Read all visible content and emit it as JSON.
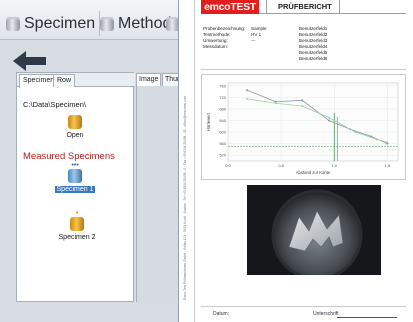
{
  "ribbon": {
    "tabs": [
      {
        "label": "Specimen"
      },
      {
        "label": "Method"
      }
    ]
  },
  "panel": {
    "tabs": [
      {
        "label": "Specimen"
      },
      {
        "label": "Row"
      }
    ],
    "path": "C:\\Data\\Specimen\\",
    "open_label": "Open",
    "measured_title": "Measured Specimens",
    "specimens": [
      {
        "label": "Specimen 1",
        "selected": true
      },
      {
        "label": "Specimen 2",
        "selected": false
      }
    ]
  },
  "viewer": {
    "tabs": [
      {
        "label": "Image"
      },
      {
        "label": "Thum"
      }
    ]
  },
  "report": {
    "logo": "emcoTEST",
    "title": "PRÜFBERICHT",
    "side_text": "Emco-Test Prüfmaschinen GmbH · Kellau 174 · 5431 Kuchl · Austria · Tel +43 6244 20438 - 0 · Fax +43 6244 20438 - 32 · office@emcotest.com",
    "info": [
      {
        "key": "Probenbezeichnung:",
        "value": "Sample"
      },
      {
        "key": "Testmethode:",
        "value": "HV 1"
      },
      {
        "key": "Umwertung:",
        "value": "---"
      },
      {
        "key": "Messdatum:",
        "value": ""
      }
    ],
    "user_fields": [
      "Benutzerfeld1",
      "Benutzerfeld2",
      "Benutzerfeld3",
      "Benutzerfeld4",
      "Benutzerfeld5",
      "Benutzerfeld6"
    ],
    "footer_date": "Datum:",
    "footer_sign": "Unterschrift"
  },
  "chart_data": {
    "type": "line",
    "title": "",
    "xlabel": "Abstand zur Kante",
    "ylabel": "Härtewert",
    "xlim": [
      0,
      1.6
    ],
    "ylim": [
      500,
      770
    ],
    "xticks": [
      "0.0",
      "0.5",
      "1.0",
      "1.5"
    ],
    "yticks": [
      "520",
      "560",
      "600",
      "640",
      "680",
      "720",
      "760"
    ],
    "grid": true,
    "colors": {
      "series1": "#8c96a3",
      "series2": "#9fd0a6",
      "threshold": "#3e9a4e"
    },
    "series": [
      {
        "x": [
          0.18,
          0.45,
          0.7,
          0.95,
          1.15,
          1.35,
          1.5
        ],
        "y": [
          745,
          705,
          710,
          640,
          610,
          585,
          560
        ]
      },
      {
        "x": [
          0.18,
          0.45,
          0.7,
          0.95,
          1.2,
          1.4,
          1.5
        ],
        "y": [
          715,
          700,
          690,
          650,
          600,
          575,
          565
        ]
      }
    ],
    "threshold_x": 1.0,
    "threshold_y": 550
  },
  "colors": {
    "accent": "#e31c1c",
    "selection": "#3b78c2",
    "measured_title": "#b22222"
  }
}
